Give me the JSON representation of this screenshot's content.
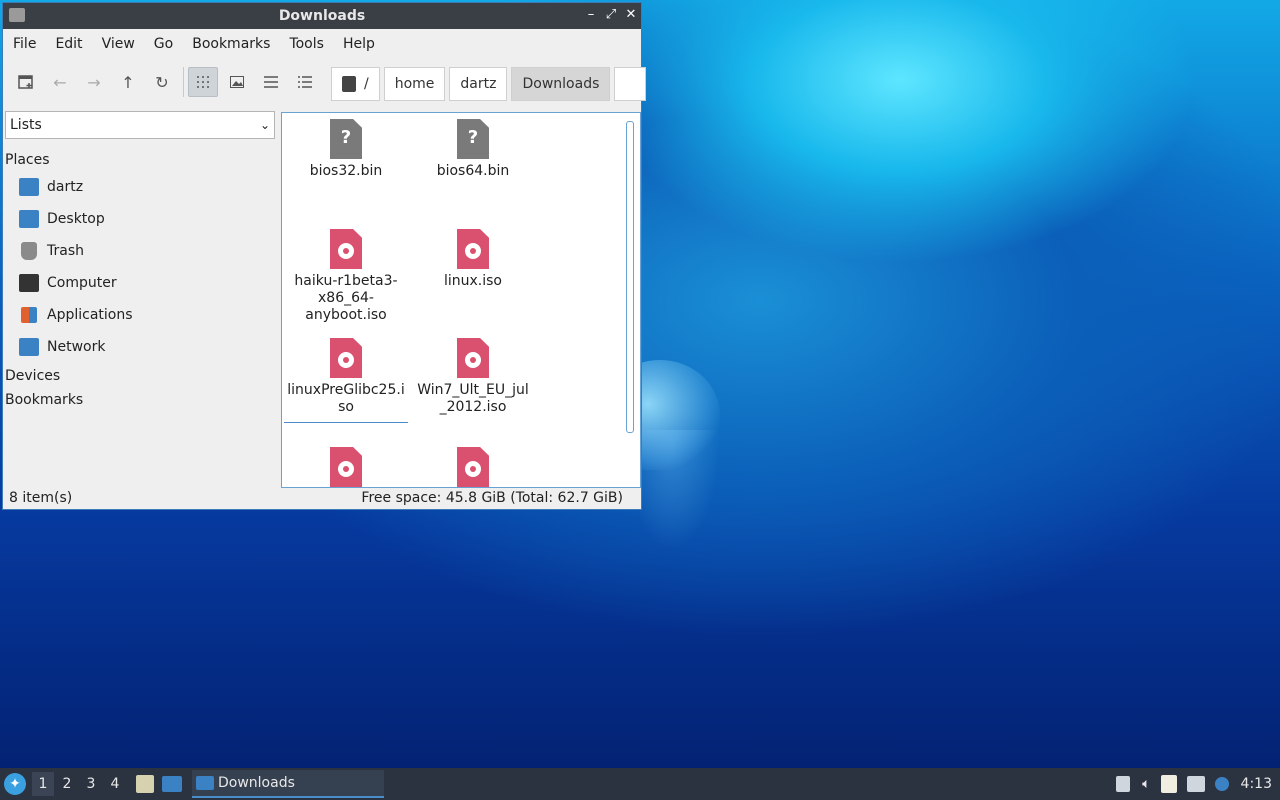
{
  "window": {
    "title": "Downloads",
    "controls": [
      "–",
      "⤢",
      "✕"
    ]
  },
  "menu": [
    "File",
    "Edit",
    "View",
    "Go",
    "Bookmarks",
    "Tools",
    "Help"
  ],
  "breadcrumbs": {
    "root": "/",
    "items": [
      "home",
      "dartz",
      "Downloads"
    ]
  },
  "sidebar": {
    "selector": "Lists",
    "places_heading": "Places",
    "places": [
      {
        "label": "dartz",
        "icon": "home-folder-icon",
        "color": "#3b82c4"
      },
      {
        "label": "Desktop",
        "icon": "desktop-icon",
        "color": "#3b82c4"
      },
      {
        "label": "Trash",
        "icon": "trash-icon",
        "color": "#8a8a8a"
      },
      {
        "label": "Computer",
        "icon": "computer-icon",
        "color": "#333333"
      },
      {
        "label": "Applications",
        "icon": "applications-icon",
        "color": "#e06030"
      },
      {
        "label": "Network",
        "icon": "network-icon",
        "color": "#3b82c4"
      }
    ],
    "devices_heading": "Devices",
    "bookmarks_heading": "Bookmarks"
  },
  "files": [
    {
      "name": "bios32.bin",
      "type": "bin"
    },
    {
      "name": "bios64.bin",
      "type": "bin"
    },
    {
      "name": "haiku-r1beta3-x86_64-anyboot.iso",
      "type": "iso"
    },
    {
      "name": "linux.iso",
      "type": "iso"
    },
    {
      "name": "linuxPreGlibc25.iso",
      "type": "iso"
    },
    {
      "name": "Win7_Ult_EU_jul_2012.iso",
      "type": "iso"
    },
    {
      "name": "",
      "type": "iso"
    },
    {
      "name": "",
      "type": "iso"
    }
  ],
  "file_labels": {
    "f0": "bios32.bin",
    "f1": "bios64.bin",
    "f2": "haiku-r1beta3-\nx86_64-\nanyboot.iso",
    "f3": "linux.iso",
    "f4": "linuxPreGlibc25.i\nso",
    "f5": "Win7_Ult_EU_jul\n_2012.iso"
  },
  "status": {
    "items": "8 item(s)",
    "space": "Free space: 45.8 GiB (Total: 62.7 GiB)"
  },
  "taskbar": {
    "workspaces": [
      "1",
      "2",
      "3",
      "4"
    ],
    "task_label": "Downloads",
    "clock": "4:13"
  }
}
